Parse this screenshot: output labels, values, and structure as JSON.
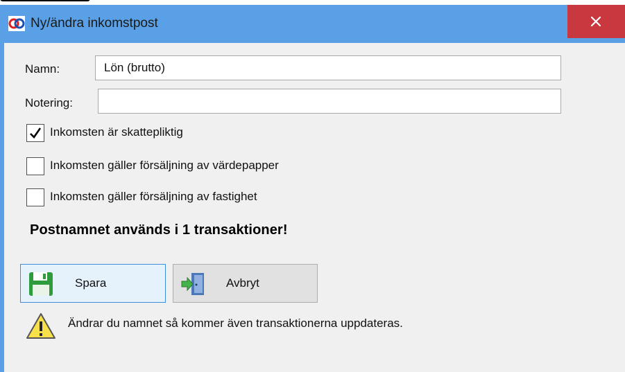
{
  "window": {
    "title": "Ny/ändra inkomstpost",
    "close_glyph": "×",
    "colors": {
      "titlebar": "#5aa0e6",
      "close": "#c9383e"
    }
  },
  "form": {
    "name_label": "Namn:",
    "name_value": "Lön (brutto)",
    "note_label": "Notering:",
    "note_value": ""
  },
  "options": [
    {
      "label": "Inkomsten är skattepliktig",
      "checked": true
    },
    {
      "label": "Inkomsten gäller försäljning av värdepapper",
      "checked": false
    },
    {
      "label": "Inkomsten gäller försäljning av fastighet",
      "checked": false
    }
  ],
  "usage_warning": "Postnamnet används i 1 transaktioner!",
  "buttons": {
    "save_label": "Spara",
    "cancel_label": "Avbryt"
  },
  "info": {
    "text": "Ändrar du namnet så kommer även transaktionerna uppdateras."
  },
  "icons": {
    "app": "app-logo-icon",
    "save": "floppy-disk-icon",
    "cancel": "exit-door-icon",
    "warning": "warning-triangle-icon",
    "check": "checkmark-icon"
  }
}
